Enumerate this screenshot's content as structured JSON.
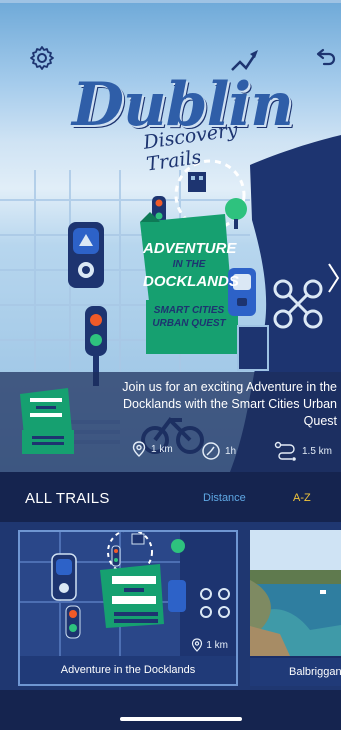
{
  "hero": {
    "logo_title": "Dublin",
    "logo_subtitle": "Discovery Trails",
    "featured_title_line1": "ADVENTURE",
    "featured_title_line2": "IN THE",
    "featured_title_line3": "DOCKLANDS",
    "featured_tagline_line1": "SMART CITIES",
    "featured_tagline_line2": "URBAN QUEST",
    "description": "Join us for an exciting Adventure in the Docklands with the Smart Cities Urban Quest",
    "distance": "1 km",
    "duration": "1h",
    "route_length": "1.5 km",
    "icons": {
      "settings": "gear-icon",
      "back": "return-arrow-icon",
      "next": "chevron-right-icon"
    }
  },
  "trails": {
    "title": "ALL TRAILS",
    "sort_distance": "Distance",
    "sort_az": "A-Z",
    "cards": [
      {
        "name": "Adventure in the Docklands",
        "distance": "1 km"
      },
      {
        "name": "Balbriggan"
      }
    ]
  },
  "colors": {
    "background": "#15244f",
    "accent_blue": "#5fa8e4",
    "accent_yellow": "#f2c63b",
    "badge_green": "#16a070"
  }
}
